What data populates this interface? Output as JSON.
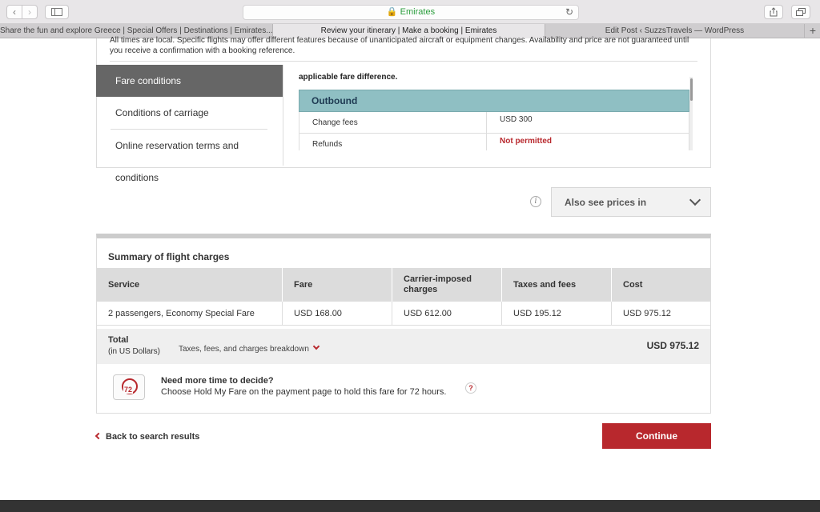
{
  "browser": {
    "url_display": "Emirates",
    "tabs": [
      {
        "label": "Share the fun and explore Greece | Special Offers | Destinations | Emirates...",
        "active": false
      },
      {
        "label": "Review your itinerary | Make a booking | Emirates",
        "active": true
      },
      {
        "label": "Edit Post ‹ SuzzsTravels — WordPress",
        "active": false
      }
    ],
    "new_tab": "+"
  },
  "intro": {
    "text": "All times are local. Specific flights may offer different features because of unanticipated aircraft or equipment changes. Availability and price are not guaranteed until you receive a confirmation with a booking reference."
  },
  "fare_nav": [
    {
      "label": "Fare conditions",
      "active": true
    },
    {
      "label": "Conditions of carriage",
      "active": false
    },
    {
      "label": "Online reservation terms and conditions",
      "active": false
    }
  ],
  "fare_conditions": {
    "applicable_text": "applicable fare difference.",
    "section_title": "Outbound",
    "rows": [
      {
        "label": "Change fees",
        "value": "USD 300"
      },
      {
        "label": "Refunds",
        "value": "Not permitted"
      }
    ]
  },
  "currency": {
    "label": "Also see prices in",
    "info_icon": "i"
  },
  "summary": {
    "title": "Summary of flight charges",
    "headers": [
      "Service",
      "Fare",
      "Carrier-imposed charges",
      "Taxes and fees",
      "Cost"
    ],
    "rows": [
      [
        "2 passengers, Economy Special Fare",
        "USD 168.00",
        "USD 612.00",
        "USD 195.12",
        "USD 975.12"
      ]
    ],
    "total_label": "Total",
    "total_sub": "(in US Dollars)",
    "breakdown_label": "Taxes, fees, and charges breakdown",
    "total_amount": "USD 975.12"
  },
  "hold": {
    "icon_number": "72",
    "title": "Need more time to decide?",
    "text": "Choose Hold My Fare on the payment page to hold this fare for 72 hours.",
    "help": "?"
  },
  "actions": {
    "back_label": "Back to search results",
    "continue_label": "Continue"
  },
  "colors": {
    "brand_red": "#b8282d",
    "outbound_header": "#8fbfc3"
  }
}
